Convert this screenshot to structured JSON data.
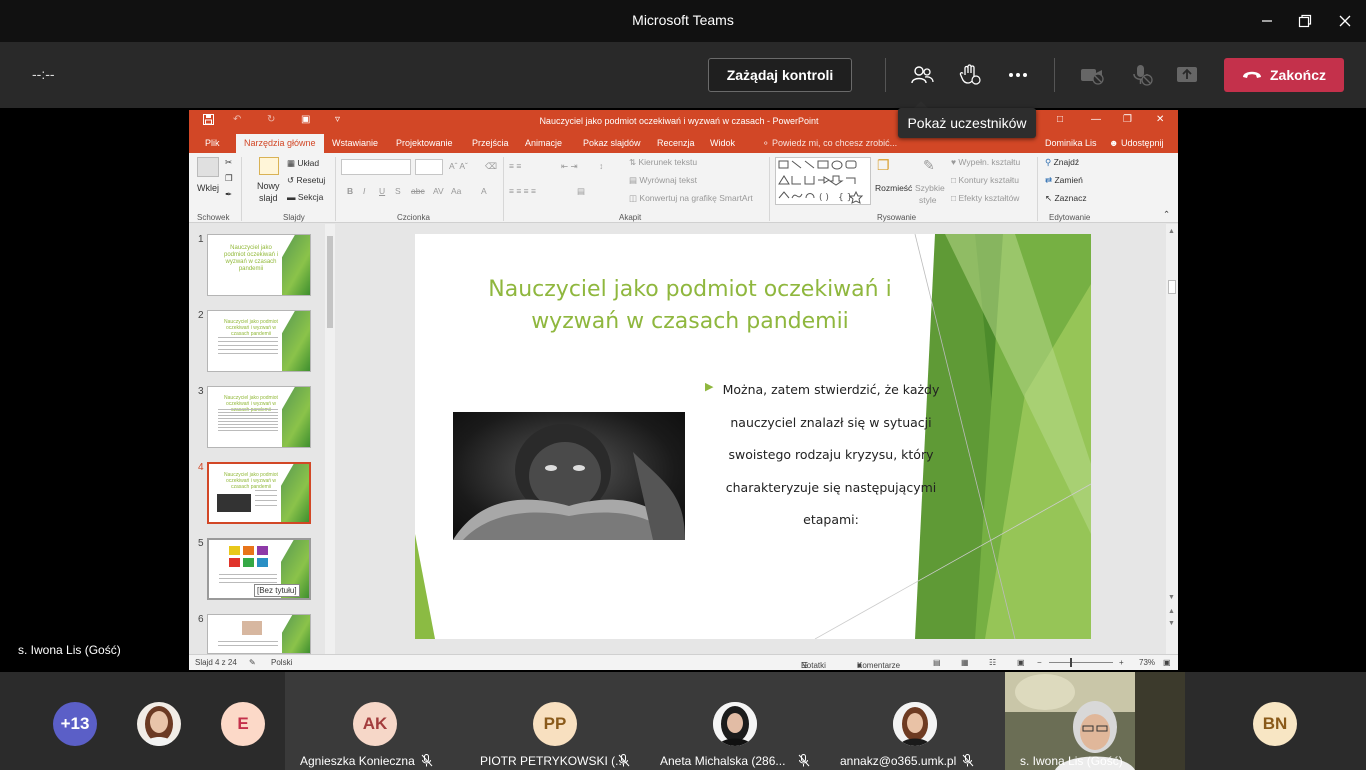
{
  "window": {
    "title": "Microsoft Teams"
  },
  "controls": {
    "timer": "--:--",
    "request_control_label": "Zażądaj kontroli",
    "end_call_label": "Zakończ",
    "tooltip": "Pokaż uczestników"
  },
  "stage": {
    "presenter_name": "s. Iwona Lis (Gość)"
  },
  "ppt": {
    "window_title": "Nauczyciel jako podmiot oczekiwań i wyzwań w czasach - PowerPoint",
    "user": "Dominika Lis",
    "share": "Udostępnij",
    "tell_me": "Powiedz mi, co chcesz zrobić...",
    "tabs": [
      "Plik",
      "Narzędzia główne",
      "Wstawianie",
      "Projektowanie",
      "Przejścia",
      "Animacje",
      "Pokaz slajdów",
      "Recenzja",
      "Widok"
    ],
    "ribbon": {
      "paste": "Wklej",
      "new_slide_1": "Nowy",
      "new_slide_2": "slajd",
      "layout": "Układ",
      "reset": "Resetuj",
      "section": "Sekcja",
      "text_direction": "Kierunek tekstu",
      "align_text": "Wyrównaj tekst",
      "smartart": "Konwertuj na grafikę SmartArt",
      "arrange": "Rozmieść",
      "quick_styles_1": "Szybkie",
      "quick_styles_2": "style",
      "shape_fill": "Wypełn. kształtu",
      "shape_outline": "Kontury kształtu",
      "shape_effects": "Efekty kształtów",
      "find": "Znajdź",
      "replace": "Zamień",
      "select": "Zaznacz",
      "groups": [
        "Schowek",
        "Slajdy",
        "Czcionka",
        "Akapit",
        "Rysowanie",
        "Edytowanie"
      ]
    },
    "thumbnails": [
      {
        "num": "1",
        "title": "Nauczyciel jako podmiot oczekiwań i wyzwań w czasach pandemii"
      },
      {
        "num": "2",
        "title": "Nauczyciel jako podmiot oczekiwań i wyzwań w czasach pandemii"
      },
      {
        "num": "3",
        "title": "Nauczyciel jako podmiot oczekiwań i wyzwań w czasach pandemii"
      },
      {
        "num": "4",
        "title": "Nauczyciel jako podmiot oczekiwań i wyzwań w czasach pandemii"
      },
      {
        "num": "5",
        "title": ""
      },
      {
        "num": "6",
        "title": ""
      }
    ],
    "thumb_tooltip": "[Bez tytułu]",
    "slide": {
      "title": "Nauczyciel jako podmiot oczekiwań i wyzwań w czasach pandemii",
      "bullet": "Można, zatem stwierdzić, że każdy nauczyciel znalazł się w sytuacji swoistego rodzaju kryzysu, który charakteryzuje się następującymi etapami:"
    },
    "status": {
      "slide_of": "Slajd 4 z 24",
      "language": "Polski",
      "notes": "Notatki",
      "comments": "Komentarze",
      "zoom": "73%"
    },
    "accent": "#d24726"
  },
  "participants": [
    {
      "initials": "+13",
      "name": "",
      "color": "#5b5fc7"
    },
    {
      "initials": "",
      "name": "",
      "color": "#caa08a"
    },
    {
      "initials": "E",
      "name": "",
      "color": "#fcd9c8"
    },
    {
      "initials": "AK",
      "name": "Agnieszka Konieczna",
      "color": "#f6d7c8"
    },
    {
      "initials": "PP",
      "name": "PIOTR PETRYKOWSKI (...",
      "color": "#f8e0c0"
    },
    {
      "initials": "",
      "name": "Aneta Michalska (286...",
      "color": "#d9b8a0"
    },
    {
      "initials": "",
      "name": "annakz@o365.umk.pl",
      "color": "#d6a88e"
    },
    {
      "initials": "",
      "name": "s. Iwona Lis (Gość)",
      "color": "#9a9a7a"
    },
    {
      "initials": "BN",
      "name": "",
      "color": "#f8e6c4"
    }
  ]
}
